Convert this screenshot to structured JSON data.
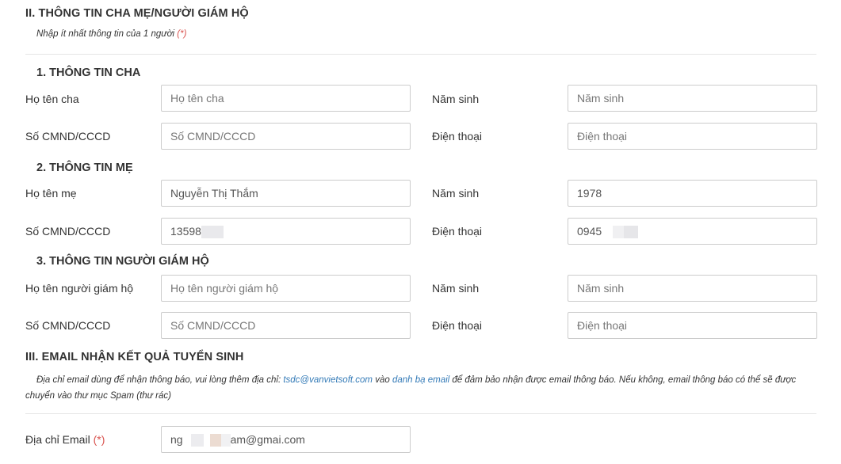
{
  "section2": {
    "title": "II. THÔNG TIN CHA MẸ/NGƯỜI GIÁM HỘ",
    "note": "Nhập ít nhất thông tin của 1 người",
    "note_req": "(*)"
  },
  "father": {
    "title": "1. THÔNG TIN CHA",
    "name_label": "Họ tên cha",
    "name_placeholder": "Họ tên cha",
    "name_value": "",
    "birth_label": "Năm sinh",
    "birth_placeholder": "Năm sinh",
    "birth_value": "",
    "id_label": "Số CMND/CCCD",
    "id_placeholder": "Số CMND/CCCD",
    "id_value": "",
    "phone_label": "Điện thoại",
    "phone_placeholder": "Điện thoại",
    "phone_value": ""
  },
  "mother": {
    "title": "2. THÔNG TIN MẸ",
    "name_label": "Họ tên mẹ",
    "name_value": "Nguyễn Thị Thắm",
    "birth_label": "Năm sinh",
    "birth_value": "1978",
    "id_label": "Số CMND/CCCD",
    "id_value_visible": "13598",
    "phone_label": "Điện thoại",
    "phone_value_visible": "0945"
  },
  "guardian": {
    "title": "3. THÔNG TIN NGƯỜI GIÁM HỘ",
    "name_label": "Họ tên người giám hộ",
    "name_placeholder": "Họ tên người giám hộ",
    "name_value": "",
    "birth_label": "Năm sinh",
    "birth_placeholder": "Năm sinh",
    "birth_value": "",
    "id_label": "Số CMND/CCCD",
    "id_placeholder": "Số CMND/CCCD",
    "id_value": "",
    "phone_label": "Điện thoại",
    "phone_placeholder": "Điện thoại",
    "phone_value": ""
  },
  "section3": {
    "title": "III. EMAIL NHẬN KẾT QUẢ TUYỂN SINH",
    "note_part1": "Địa chỉ email dùng để nhận thông báo, vui lòng thêm địa chỉ: ",
    "note_email": "tsdc@vanvietsoft.com",
    "note_part2": " vào ",
    "note_link": "danh bạ email",
    "note_part3": " để đảm bảo nhận được email thông báo. Nếu không, email thông báo có thể sẽ được chuyển vào thư mục Spam (thư rác)",
    "email_label": "Địa chỉ Email",
    "email_req": "(*)",
    "email_visible_start": "ng",
    "email_visible_end": "am@gmai.com"
  },
  "colors": {
    "text": "#333333",
    "required": "#d9534f",
    "link": "#337ab7",
    "border": "#cccccc",
    "mask_gray": "#e9e9ec",
    "mask_tan": "#ecdcd2"
  }
}
